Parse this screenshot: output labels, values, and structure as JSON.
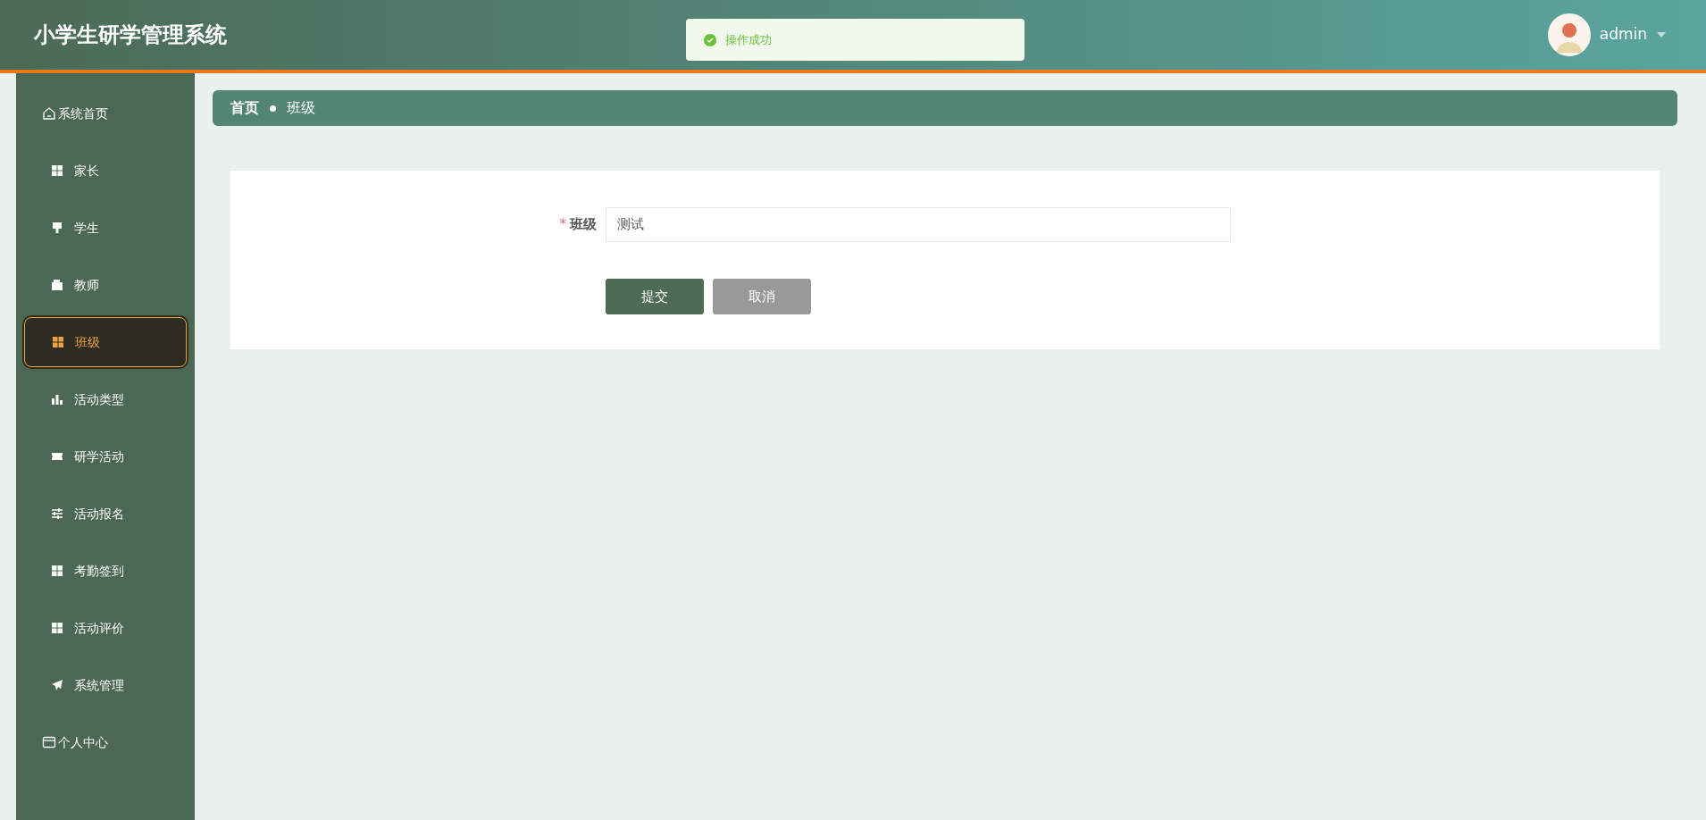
{
  "header": {
    "title": "小学生研学管理系统",
    "user": "admin"
  },
  "toast": {
    "message": "操作成功"
  },
  "sidebar": {
    "items": [
      {
        "label": "系统首页",
        "kind": "top",
        "selected": false
      },
      {
        "label": "家长",
        "kind": "sub",
        "selected": false
      },
      {
        "label": "学生",
        "kind": "sub",
        "selected": false
      },
      {
        "label": "教师",
        "kind": "sub",
        "selected": false
      },
      {
        "label": "班级",
        "kind": "sub",
        "selected": true
      },
      {
        "label": "活动类型",
        "kind": "sub",
        "selected": false
      },
      {
        "label": "研学活动",
        "kind": "sub",
        "selected": false
      },
      {
        "label": "活动报名",
        "kind": "sub",
        "selected": false
      },
      {
        "label": "考勤签到",
        "kind": "sub",
        "selected": false
      },
      {
        "label": "活动评价",
        "kind": "sub",
        "selected": false
      },
      {
        "label": "系统管理",
        "kind": "sub",
        "selected": false
      },
      {
        "label": "个人中心",
        "kind": "top",
        "selected": false
      }
    ]
  },
  "breadcrumb": [
    {
      "label": "首页"
    },
    {
      "label": "班级"
    }
  ],
  "form": {
    "fields": [
      {
        "label": "班级",
        "required_mark": "*",
        "value": "测试"
      }
    ],
    "buttons": [
      {
        "label": "提交",
        "kind": "primary"
      },
      {
        "label": "取消",
        "kind": "secondary"
      }
    ]
  }
}
